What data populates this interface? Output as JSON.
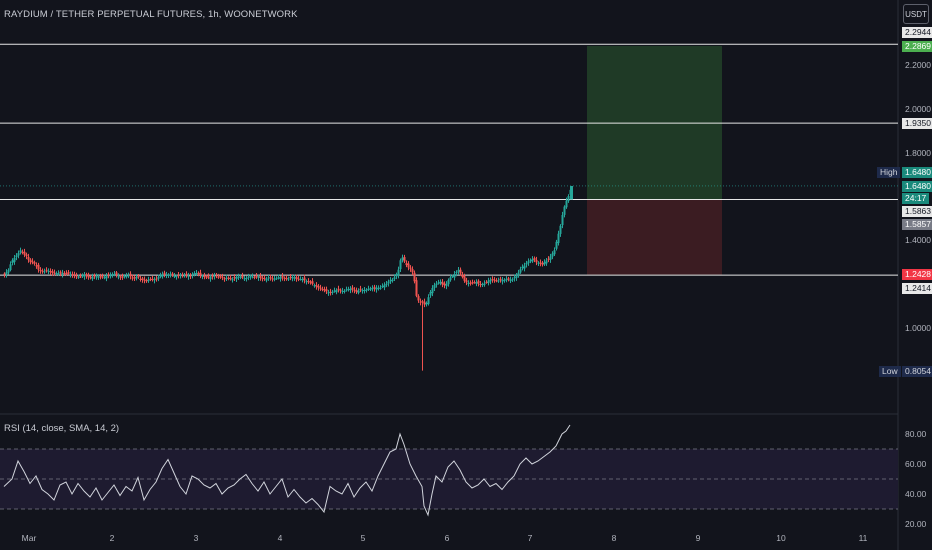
{
  "header": {
    "title": "RAYDIUM / TETHER PERPETUAL FUTURES, 1h, WOONETWORK",
    "currency_button": "USDT"
  },
  "rsi_pane": {
    "title": "RSI (14, close, SMA, 14, 2)"
  },
  "colors": {
    "bg": "#12141c",
    "up": "#26a69a",
    "down": "#ef5350",
    "target_zone": "#1f3a26",
    "stop_zone": "#3b1c22",
    "rsi_line": "#d1d4dc",
    "rsi_band": "#1e1b30"
  },
  "chart_data": [
    {
      "type": "candlestick",
      "ylim": [
        0.75,
        2.35
      ],
      "y_ticks": [
        "2.2000",
        "2.0000",
        "1.8000",
        "1.4000",
        "1.0000"
      ],
      "x_ticks": [
        "Mar",
        "2",
        "3",
        "4",
        "5",
        "6",
        "7",
        "8",
        "9",
        "10",
        "11"
      ],
      "horizontal_lines": [
        2.2944,
        1.935,
        1.5863,
        1.2414
      ],
      "position_zone": {
        "entry": 1.5863,
        "target": 2.2869,
        "stop": 1.2428
      },
      "price_labels": [
        {
          "value": "2.2944",
          "style": "plain"
        },
        {
          "value": "2.2869",
          "style": "green"
        },
        {
          "value": "1.9350",
          "style": "plain"
        },
        {
          "value": "1.6480",
          "style": "teal",
          "tag": "High"
        },
        {
          "value": "1.6480",
          "style": "teal"
        },
        {
          "value": "24:17",
          "style": "teal"
        },
        {
          "value": "1.5863",
          "style": "plain"
        },
        {
          "value": "1.5857",
          "style": "gray"
        },
        {
          "value": "1.2428",
          "style": "red"
        },
        {
          "value": "1.2414",
          "style": "plain"
        },
        {
          "value": "0.8054",
          "style": "navy",
          "tag": "Low"
        }
      ],
      "high": 1.648,
      "low": 0.8054,
      "close_path": [
        [
          0,
          1.2446
        ],
        [
          4,
          1.2648
        ],
        [
          7,
          1.3033
        ],
        [
          10,
          1.3203
        ],
        [
          13,
          1.3358
        ],
        [
          16,
          1.3544
        ],
        [
          19,
          1.3374
        ],
        [
          22,
          1.3281
        ],
        [
          25,
          1.3033
        ],
        [
          28,
          1.2989
        ],
        [
          31,
          1.2895
        ],
        [
          34,
          1.2664
        ],
        [
          37,
          1.2587
        ],
        [
          40,
          1.2586
        ],
        [
          43,
          1.2633
        ],
        [
          46,
          1.2568
        ],
        [
          49,
          1.2488
        ],
        [
          52,
          1.2508
        ],
        [
          55,
          1.2487
        ],
        [
          58,
          1.2512
        ],
        [
          61,
          1.2505
        ],
        [
          64,
          1.2476
        ],
        [
          67,
          1.2434
        ],
        [
          70,
          1.2407
        ],
        [
          73,
          1.2335
        ],
        [
          76,
          1.2352
        ],
        [
          79,
          1.2438
        ],
        [
          82,
          1.2383
        ],
        [
          85,
          1.2287
        ],
        [
          88,
          1.2335
        ],
        [
          91,
          1.2352
        ],
        [
          94,
          1.2354
        ],
        [
          97,
          1.2316
        ],
        [
          100,
          1.2315
        ],
        [
          103,
          1.2417
        ],
        [
          106,
          1.2401
        ],
        [
          109,
          1.2492
        ],
        [
          112,
          1.2403
        ],
        [
          115,
          1.2334
        ],
        [
          118,
          1.2327
        ],
        [
          121,
          1.2377
        ],
        [
          124,
          1.2416
        ],
        [
          127,
          1.2321
        ],
        [
          130,
          1.2266
        ],
        [
          133,
          1.2357
        ],
        [
          136,
          1.2227
        ],
        [
          139,
          1.2183
        ],
        [
          142,
          1.2178
        ],
        [
          145,
          1.2211
        ],
        [
          148,
          1.2237
        ],
        [
          151,
          1.2212
        ],
        [
          154,
          1.2326
        ],
        [
          157,
          1.2451
        ],
        [
          160,
          1.2438
        ],
        [
          163,
          1.2418
        ],
        [
          166,
          1.2439
        ],
        [
          169,
          1.2375
        ],
        [
          172,
          1.2367
        ],
        [
          175,
          1.2423
        ],
        [
          178,
          1.2395
        ],
        [
          181,
          1.2399
        ],
        [
          184,
          1.2391
        ],
        [
          187,
          1.2365
        ],
        [
          190,
          1.2509
        ],
        [
          193,
          1.2505
        ],
        [
          196,
          1.2411
        ],
        [
          199,
          1.2356
        ],
        [
          202,
          1.2318
        ],
        [
          205,
          1.2304
        ],
        [
          208,
          1.2348
        ],
        [
          211,
          1.2422
        ],
        [
          214,
          1.2316
        ],
        [
          217,
          1.2337
        ],
        [
          220,
          1.2251
        ],
        [
          223,
          1.2306
        ],
        [
          226,
          1.2234
        ],
        [
          229,
          1.2249
        ],
        [
          232,
          1.2321
        ],
        [
          235,
          1.2363
        ],
        [
          238,
          1.2296
        ],
        [
          241,
          1.2251
        ],
        [
          244,
          1.2336
        ],
        [
          247,
          1.2375
        ],
        [
          250,
          1.2299
        ],
        [
          253,
          1.2382
        ],
        [
          256,
          1.2292
        ],
        [
          259,
          1.2227
        ],
        [
          262,
          1.2237
        ],
        [
          265,
          1.2325
        ],
        [
          268,
          1.2251
        ],
        [
          271,
          1.2248
        ],
        [
          274,
          1.2312
        ],
        [
          277,
          1.2318
        ],
        [
          280,
          1.2269
        ],
        [
          283,
          1.2256
        ],
        [
          286,
          1.2281
        ],
        [
          289,
          1.2341
        ],
        [
          292,
          1.2239
        ],
        [
          295,
          1.2235
        ],
        [
          298,
          1.2229
        ],
        [
          301,
          1.2137
        ],
        [
          304,
          1.2137
        ],
        [
          307,
          1.2039
        ],
        [
          310,
          1.1951
        ],
        [
          313,
          1.1856
        ],
        [
          316,
          1.1813
        ],
        [
          319,
          1.1732
        ],
        [
          322,
          1.1669
        ],
        [
          325,
          1.1609
        ],
        [
          328,
          1.1646
        ],
        [
          331,
          1.1733
        ],
        [
          334,
          1.1741
        ],
        [
          337,
          1.1696
        ],
        [
          340,
          1.1691
        ],
        [
          343,
          1.1784
        ],
        [
          346,
          1.1786
        ],
        [
          349,
          1.1748
        ],
        [
          352,
          1.1649
        ],
        [
          355,
          1.1744
        ],
        [
          358,
          1.1727
        ],
        [
          361,
          1.1734
        ],
        [
          364,
          1.1787
        ],
        [
          367,
          1.1821
        ],
        [
          370,
          1.1796
        ],
        [
          373,
          1.1844
        ],
        [
          376,
          1.1836
        ],
        [
          379,
          1.196
        ],
        [
          382,
          1.2016
        ],
        [
          385,
          1.2168
        ],
        [
          388,
          1.2213
        ],
        [
          391,
          1.2362
        ],
        [
          394,
          1.2661
        ],
        [
          397,
          1.3303
        ],
        [
          400,
          1.3033
        ],
        [
          403,
          1.2796
        ],
        [
          406,
          1.2701
        ],
        [
          409,
          1.2466
        ],
        [
          412,
          1.1467
        ],
        [
          415,
          1.1146
        ],
        [
          418,
          1.1207
        ],
        [
          421,
          1.1008
        ],
        [
          424,
          1.1405
        ],
        [
          427,
          1.1762
        ],
        [
          430,
          1.1958
        ],
        [
          433,
          1.2058
        ],
        [
          436,
          1.211
        ],
        [
          439,
          1.1921
        ],
        [
          442,
          1.2005
        ],
        [
          445,
          1.2281
        ],
        [
          448,
          1.2376
        ],
        [
          451,
          1.2507
        ],
        [
          454,
          1.265
        ],
        [
          457,
          1.2408
        ],
        [
          460,
          1.2153
        ],
        [
          463,
          1.2049
        ],
        [
          466,
          1.2065
        ],
        [
          469,
          1.2081
        ],
        [
          472,
          1.2087
        ],
        [
          475,
          1.2001
        ],
        [
          478,
          1.1998
        ],
        [
          481,
          1.2052
        ],
        [
          484,
          1.2162
        ],
        [
          487,
          1.2215
        ],
        [
          490,
          1.2184
        ],
        [
          493,
          1.216
        ],
        [
          496,
          1.2185
        ],
        [
          499,
          1.219
        ],
        [
          502,
          1.2225
        ],
        [
          505,
          1.2194
        ],
        [
          508,
          1.2226
        ],
        [
          511,
          1.2353
        ],
        [
          514,
          1.2525
        ],
        [
          517,
          1.2758
        ],
        [
          520,
          1.2853
        ],
        [
          523,
          1.3019
        ],
        [
          526,
          1.3092
        ],
        [
          529,
          1.3162
        ],
        [
          532,
          1.3001
        ],
        [
          535,
          1.2966
        ],
        [
          538,
          1.2898
        ],
        [
          541,
          1.3059
        ],
        [
          544,
          1.3142
        ],
        [
          547,
          1.332
        ],
        [
          550,
          1.3548
        ],
        [
          553,
          1.4122
        ],
        [
          556,
          1.4664
        ],
        [
          559,
          1.5402
        ],
        [
          562,
          1.5809
        ],
        [
          565,
          1.6124
        ],
        [
          567,
          1.648
        ]
      ]
    },
    {
      "type": "line",
      "name": "RSI",
      "ylim": [
        20,
        90
      ],
      "y_ticks": [
        "80.00",
        "60.00",
        "40.00",
        "20.00"
      ],
      "bands": [
        70,
        50,
        30
      ],
      "values": [
        [
          0,
          45
        ],
        [
          8,
          50
        ],
        [
          14,
          62
        ],
        [
          20,
          55
        ],
        [
          26,
          47
        ],
        [
          32,
          52
        ],
        [
          38,
          43
        ],
        [
          44,
          40
        ],
        [
          50,
          36
        ],
        [
          56,
          46
        ],
        [
          62,
          48
        ],
        [
          68,
          40
        ],
        [
          74,
          47
        ],
        [
          80,
          42
        ],
        [
          86,
          38
        ],
        [
          92,
          44
        ],
        [
          98,
          36
        ],
        [
          104,
          41
        ],
        [
          110,
          46
        ],
        [
          116,
          39
        ],
        [
          122,
          45
        ],
        [
          128,
          42
        ],
        [
          134,
          51
        ],
        [
          140,
          36
        ],
        [
          146,
          43
        ],
        [
          152,
          48
        ],
        [
          158,
          57
        ],
        [
          164,
          63
        ],
        [
          170,
          54
        ],
        [
          176,
          45
        ],
        [
          182,
          40
        ],
        [
          188,
          52
        ],
        [
          194,
          50
        ],
        [
          200,
          46
        ],
        [
          206,
          44
        ],
        [
          212,
          47
        ],
        [
          218,
          40
        ],
        [
          224,
          44
        ],
        [
          230,
          46
        ],
        [
          236,
          50
        ],
        [
          242,
          53
        ],
        [
          248,
          47
        ],
        [
          254,
          42
        ],
        [
          260,
          48
        ],
        [
          266,
          40
        ],
        [
          272,
          45
        ],
        [
          278,
          50
        ],
        [
          284,
          38
        ],
        [
          290,
          43
        ],
        [
          296,
          38
        ],
        [
          302,
          34
        ],
        [
          308,
          37
        ],
        [
          314,
          33
        ],
        [
          320,
          28
        ],
        [
          326,
          45
        ],
        [
          332,
          42
        ],
        [
          338,
          40
        ],
        [
          344,
          47
        ],
        [
          350,
          38
        ],
        [
          356,
          44
        ],
        [
          362,
          48
        ],
        [
          368,
          42
        ],
        [
          374,
          52
        ],
        [
          380,
          60
        ],
        [
          386,
          68
        ],
        [
          392,
          70
        ],
        [
          396,
          80
        ],
        [
          400,
          73
        ],
        [
          406,
          60
        ],
        [
          412,
          52
        ],
        [
          418,
          45
        ],
        [
          420,
          32
        ],
        [
          424,
          26
        ],
        [
          428,
          40
        ],
        [
          432,
          52
        ],
        [
          438,
          48
        ],
        [
          444,
          58
        ],
        [
          450,
          62
        ],
        [
          456,
          56
        ],
        [
          462,
          48
        ],
        [
          468,
          44
        ],
        [
          474,
          46
        ],
        [
          480,
          50
        ],
        [
          486,
          45
        ],
        [
          492,
          47
        ],
        [
          498,
          43
        ],
        [
          504,
          48
        ],
        [
          510,
          52
        ],
        [
          516,
          60
        ],
        [
          522,
          64
        ],
        [
          528,
          60
        ],
        [
          534,
          62
        ],
        [
          540,
          65
        ],
        [
          546,
          68
        ],
        [
          552,
          72
        ],
        [
          558,
          80
        ],
        [
          562,
          82
        ],
        [
          566,
          86
        ]
      ]
    }
  ]
}
